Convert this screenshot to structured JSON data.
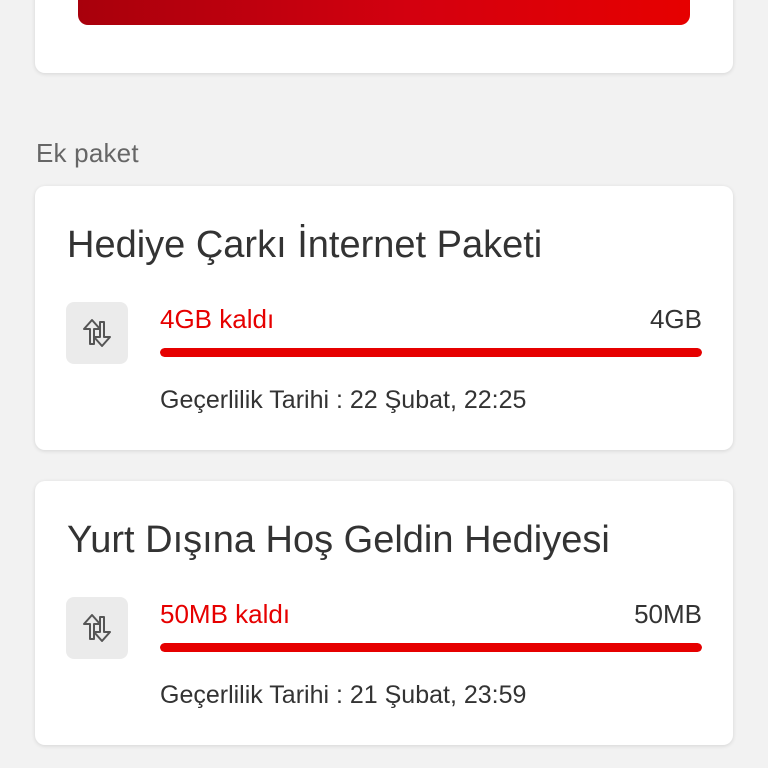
{
  "section_label": "Ek paket",
  "accent_color": "#e60000",
  "packages": [
    {
      "title": "Hediye Çarkı İnternet Paketi",
      "icon": "data-transfer-icon",
      "remaining": "4GB kaldı",
      "total": "4GB",
      "remaining_fraction": 1.0,
      "validity_label": "Geçerlilik Tarihi",
      "validity_date": "22 Şubat, 22:25"
    },
    {
      "title": "Yurt Dışına Hoş Geldin Hediyesi",
      "icon": "data-transfer-icon",
      "remaining": "50MB kaldı",
      "total": "50MB",
      "remaining_fraction": 1.0,
      "validity_label": "Geçerlilik Tarihi",
      "validity_date": "21 Şubat, 23:59"
    }
  ]
}
